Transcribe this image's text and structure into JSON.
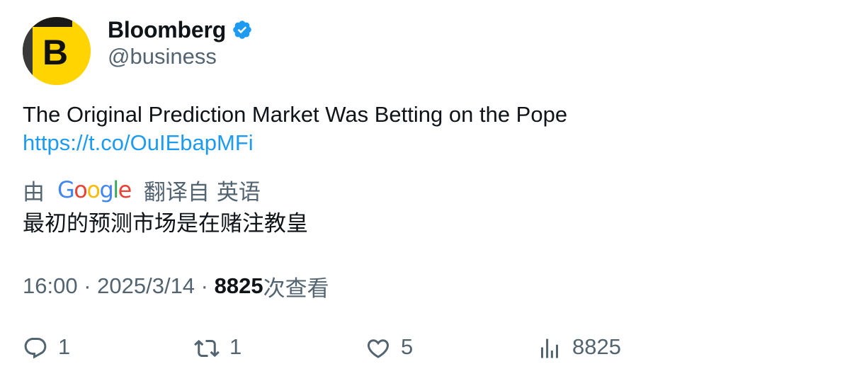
{
  "author": {
    "name": "Bloomberg",
    "handle": "@business",
    "verified": true,
    "avatar_letter": "B",
    "avatar_color": "#ffd400"
  },
  "tweet": {
    "text": "The Original Prediction Market Was Betting on the Pope",
    "link": "https://t.co/OuIEbapMFi"
  },
  "translation": {
    "prefix": "由",
    "provider_logo": [
      "G",
      "o",
      "o",
      "g",
      "l",
      "e"
    ],
    "label": "翻译自",
    "language": "英语",
    "text": "最初的预测市场是在赌注教皇"
  },
  "meta": {
    "time": "16:00",
    "separator": " · ",
    "date": "2025/3/14",
    "views_count": "8825",
    "views_label": "次查看"
  },
  "actions": {
    "reply": {
      "icon": "reply-icon",
      "count": "1"
    },
    "retweet": {
      "icon": "retweet-icon",
      "count": "1"
    },
    "like": {
      "icon": "heart-icon",
      "count": "5"
    },
    "views": {
      "icon": "analytics-icon",
      "count": "8825"
    }
  },
  "colors": {
    "link": "#1d9bf0",
    "secondary_text": "#536471",
    "primary_text": "#0f1419",
    "verified_badge": "#1d9bf0"
  }
}
